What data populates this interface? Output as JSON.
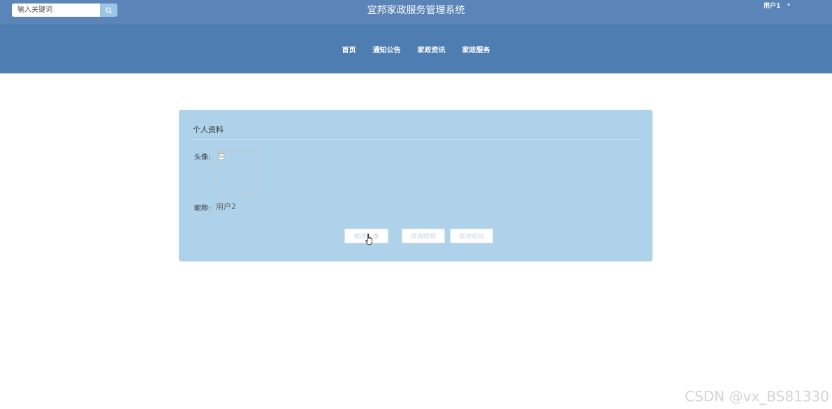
{
  "header": {
    "title": "宜邦家政服务管理系统",
    "search": {
      "placeholder": "输入关键词",
      "value": ""
    },
    "user": {
      "name": "用户1"
    }
  },
  "nav": {
    "items": [
      {
        "label": "首页"
      },
      {
        "label": "通知公告"
      },
      {
        "label": "家政资讯"
      },
      {
        "label": "家政服务"
      }
    ]
  },
  "profile": {
    "title": "个人资料",
    "avatar_label": "头像:",
    "nickname_label": "昵称:",
    "nickname_value": "用户2",
    "buttons": {
      "change_avatar": "修改头像",
      "change_nickname": "修改昵称",
      "change_password": "修改密码"
    }
  },
  "watermark": "CSDN @vx_BS81330",
  "colors": {
    "topbar": "#5b84b8",
    "navbar": "#4e7db1",
    "card": "#aed2ea",
    "search_button": "#9cc6e6"
  },
  "icons": [
    "search-icon",
    "caret-down-icon",
    "broken-image-icon",
    "hand-cursor-icon"
  ]
}
